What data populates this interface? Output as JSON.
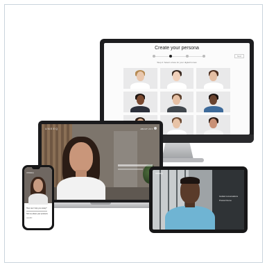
{
  "monitor": {
    "title": "Create your persona",
    "step_caption": "Step 2: Select a face for your digital human",
    "next_label": "Next",
    "steps": [
      1,
      2,
      3,
      4
    ],
    "active_step": 1,
    "faces": [
      {
        "skin": "#e9c7ad",
        "hair": "#b58a52",
        "shirt": "#ffffff"
      },
      {
        "skin": "#f0d0ba",
        "hair": "#3a2a22",
        "shirt": "#ffffff"
      },
      {
        "skin": "#e4bea3",
        "hair": "#4b2d1e",
        "shirt": "#ffffff"
      },
      {
        "skin": "#7a4a31",
        "hair": "#1c1411",
        "shirt": "#2b2f3a"
      },
      {
        "skin": "#e6c0a4",
        "hair": "#5a3e2c",
        "shirt": "#41474d"
      },
      {
        "skin": "#6a432f",
        "hair": "#1a1210",
        "shirt": "#3d6a9a"
      },
      {
        "skin": "#d8ac8e",
        "hair": "#2f1f18",
        "shirt": "#e5e5e5"
      },
      {
        "skin": "#e8c3a6",
        "hair": "#6b4a33",
        "shirt": "#ffffff"
      },
      {
        "skin": "#c89076",
        "hair": "#2a1a14",
        "shirt": "#f5f5f5"
      }
    ]
  },
  "laptop": {
    "logo": "UNEEQ",
    "menu": "ABOUT US ▾"
  },
  "phone": {
    "logo": "UNEEQ",
    "lines": [
      "How can I help you today?",
      "Tell me about your products",
      "LEARN"
    ]
  },
  "tablet": {
    "logo": "UNEEQ",
    "lines": [
      "Guided conversations",
      "Product Demo"
    ]
  }
}
